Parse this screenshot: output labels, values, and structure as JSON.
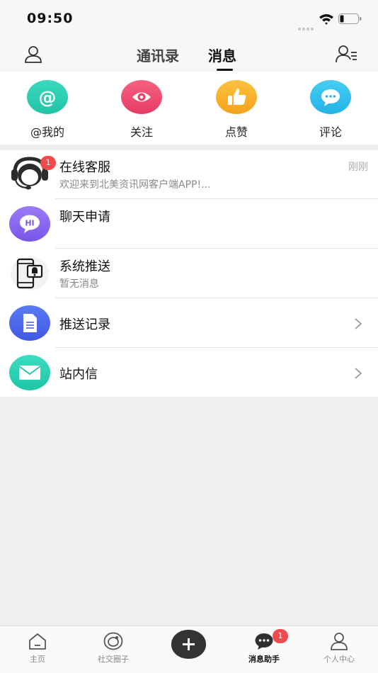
{
  "status_bar": {
    "time": "09:50"
  },
  "nav": {
    "tabs": [
      {
        "label": "通讯录"
      },
      {
        "label": "消息",
        "active": true
      }
    ]
  },
  "quick_actions": [
    {
      "label": "@我的",
      "icon": "at-icon",
      "color": "#2fd1b2"
    },
    {
      "label": "关注",
      "icon": "eye-icon",
      "color": "#f24e7a"
    },
    {
      "label": "点赞",
      "icon": "thumbs-up-icon",
      "color": "#fbb632"
    },
    {
      "label": "评论",
      "icon": "comment-icon",
      "color": "#33bff0"
    }
  ],
  "messages": [
    {
      "title": "在线客服",
      "subtitle": "欢迎来到北美资讯网客户端APP!...",
      "time": "刚刚",
      "badge": "1",
      "icon": "customer-service-icon"
    },
    {
      "title": "聊天申请",
      "icon_text": "HI",
      "icon": "chat-request-icon"
    },
    {
      "title": "系统推送",
      "subtitle": "暂无消息",
      "icon": "system-push-icon"
    },
    {
      "title": "推送记录",
      "icon": "document-icon"
    },
    {
      "title": "站内信",
      "icon": "mail-icon"
    }
  ],
  "tabbar": {
    "tabs": [
      {
        "label": "主页",
        "icon": "home-icon"
      },
      {
        "label": "社交圈子",
        "icon": "social-circle-icon"
      },
      {
        "label": "",
        "icon": "add-icon"
      },
      {
        "label": "消息助手",
        "icon": "message-icon",
        "badge": "1",
        "active": true
      },
      {
        "label": "个人中心",
        "icon": "profile-icon"
      }
    ]
  },
  "colors": {
    "badge": "#f04a4a",
    "accent": "#111111"
  }
}
